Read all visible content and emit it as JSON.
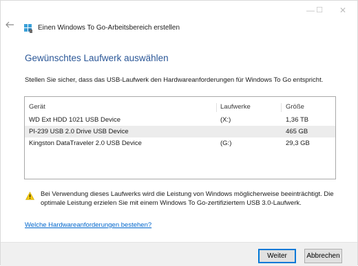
{
  "window": {
    "controls": {
      "minimize": "—",
      "maximize": "☐",
      "close": "✕"
    },
    "app_title": "Einen Windows To Go-Arbeitsbereich erstellen"
  },
  "page": {
    "heading": "Gewünschtes Laufwerk auswählen",
    "instruction": "Stellen Sie sicher, dass das USB-Laufwerk den Hardwareanforderungen für Windows To Go entspricht."
  },
  "drive_list": {
    "columns": [
      "Gerät",
      "Laufwerke",
      "Größe"
    ],
    "rows": [
      {
        "device": "WD Ext HDD 1021 USB Device",
        "letter": "(X:)",
        "size": "1,36 TB"
      },
      {
        "device": "PI-239 USB 2.0 Drive USB Device",
        "letter": "",
        "size": "465 GB"
      },
      {
        "device": "Kingston DataTraveler 2.0 USB Device",
        "letter": "(G:)",
        "size": "29,3 GB"
      }
    ]
  },
  "warning": {
    "text": "Bei Verwendung dieses Laufwerks wird die Leistung von Windows möglicherweise beeinträchtigt. Die optimale Leistung erzielen Sie mit einem Windows To Go-zertifiziertem USB 3.0-Laufwerk."
  },
  "link": {
    "text": "Welche Hardwareanforderungen bestehen?"
  },
  "buttons": {
    "next": "Weiter",
    "cancel": "Abbrechen"
  },
  "colors": {
    "heading": "#2b5797",
    "link": "#0066cc",
    "warning": "#f2c811",
    "primary_border": "#0078d7"
  }
}
